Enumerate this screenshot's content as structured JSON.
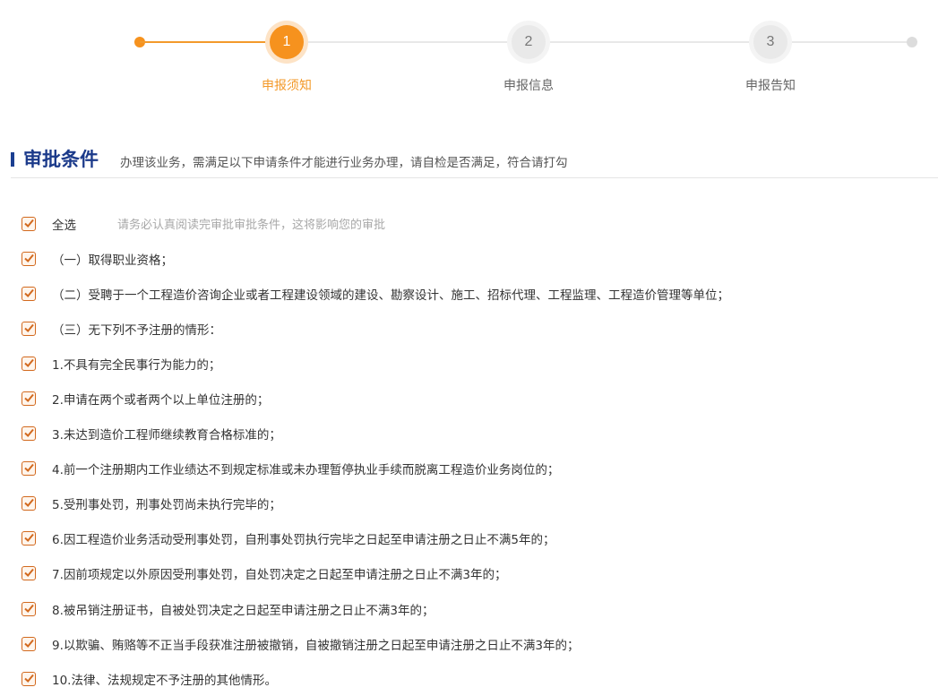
{
  "stepper": {
    "steps": [
      {
        "number": "1",
        "label": "申报须知",
        "state": "active"
      },
      {
        "number": "2",
        "label": "申报信息",
        "state": "idle"
      },
      {
        "number": "3",
        "label": "申报告知",
        "state": "idle"
      }
    ]
  },
  "section": {
    "title": "审批条件",
    "description": "办理该业务，需满足以下申请条件才能进行业务办理，请自检是否满足，符合请打勾"
  },
  "select_all": {
    "label": "全选",
    "hint": "请务必认真阅读完审批审批条件，这将影响您的审批",
    "checked": true
  },
  "conditions": [
    {
      "text": "（一）取得职业资格；",
      "checked": true
    },
    {
      "text": "（二）受聘于一个工程造价咨询企业或者工程建设领域的建设、勘察设计、施工、招标代理、工程监理、工程造价管理等单位；",
      "checked": true
    },
    {
      "text": "（三）无下列不予注册的情形：",
      "checked": true
    },
    {
      "text": "1.不具有完全民事行为能力的；",
      "checked": true
    },
    {
      "text": "2.申请在两个或者两个以上单位注册的；",
      "checked": true
    },
    {
      "text": "3.未达到造价工程师继续教育合格标准的；",
      "checked": true
    },
    {
      "text": "4.前一个注册期内工作业绩达不到规定标准或未办理暂停执业手续而脱离工程造价业务岗位的；",
      "checked": true
    },
    {
      "text": "5.受刑事处罚，刑事处罚尚未执行完毕的；",
      "checked": true
    },
    {
      "text": "6.因工程造价业务活动受刑事处罚，自刑事处罚执行完毕之日起至申请注册之日止不满5年的；",
      "checked": true
    },
    {
      "text": "7.因前项规定以外原因受刑事处罚，自处罚决定之日起至申请注册之日止不满3年的；",
      "checked": true
    },
    {
      "text": "8.被吊销注册证书，自被处罚决定之日起至申请注册之日止不满3年的；",
      "checked": true
    },
    {
      "text": "9.以欺骗、贿赂等不正当手段获准注册被撤销，自被撤销注册之日起至申请注册之日止不满3年的；",
      "checked": true
    },
    {
      "text": "10.法律、法规规定不予注册的其他情形。",
      "checked": true
    }
  ],
  "colors": {
    "accent": "#f6921e",
    "title_blue": "#1b3a8a",
    "checkbox_border": "#d2691e"
  }
}
